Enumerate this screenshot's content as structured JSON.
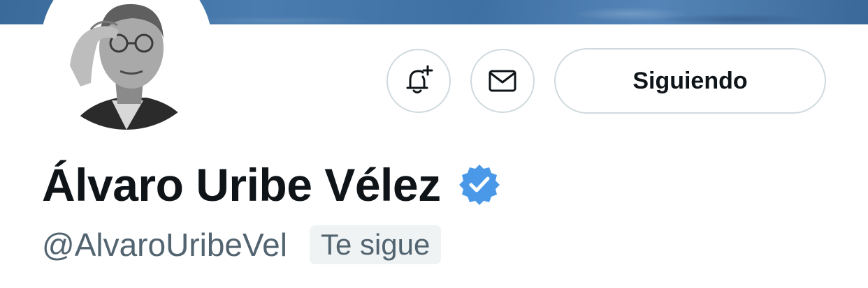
{
  "profile": {
    "display_name": "Álvaro Uribe Vélez",
    "handle": "@AlvaroUribeVel",
    "follows_you_label": "Te sigue",
    "verified": true
  },
  "actions": {
    "notifications_icon": "bell-plus-icon",
    "message_icon": "envelope-icon",
    "follow_label": "Siguiendo"
  },
  "colors": {
    "verified_badge": "#4a99e9",
    "text_primary": "#0f1419",
    "text_secondary": "#536471",
    "border": "#cfd9de",
    "banner": "#4a7cb0"
  }
}
